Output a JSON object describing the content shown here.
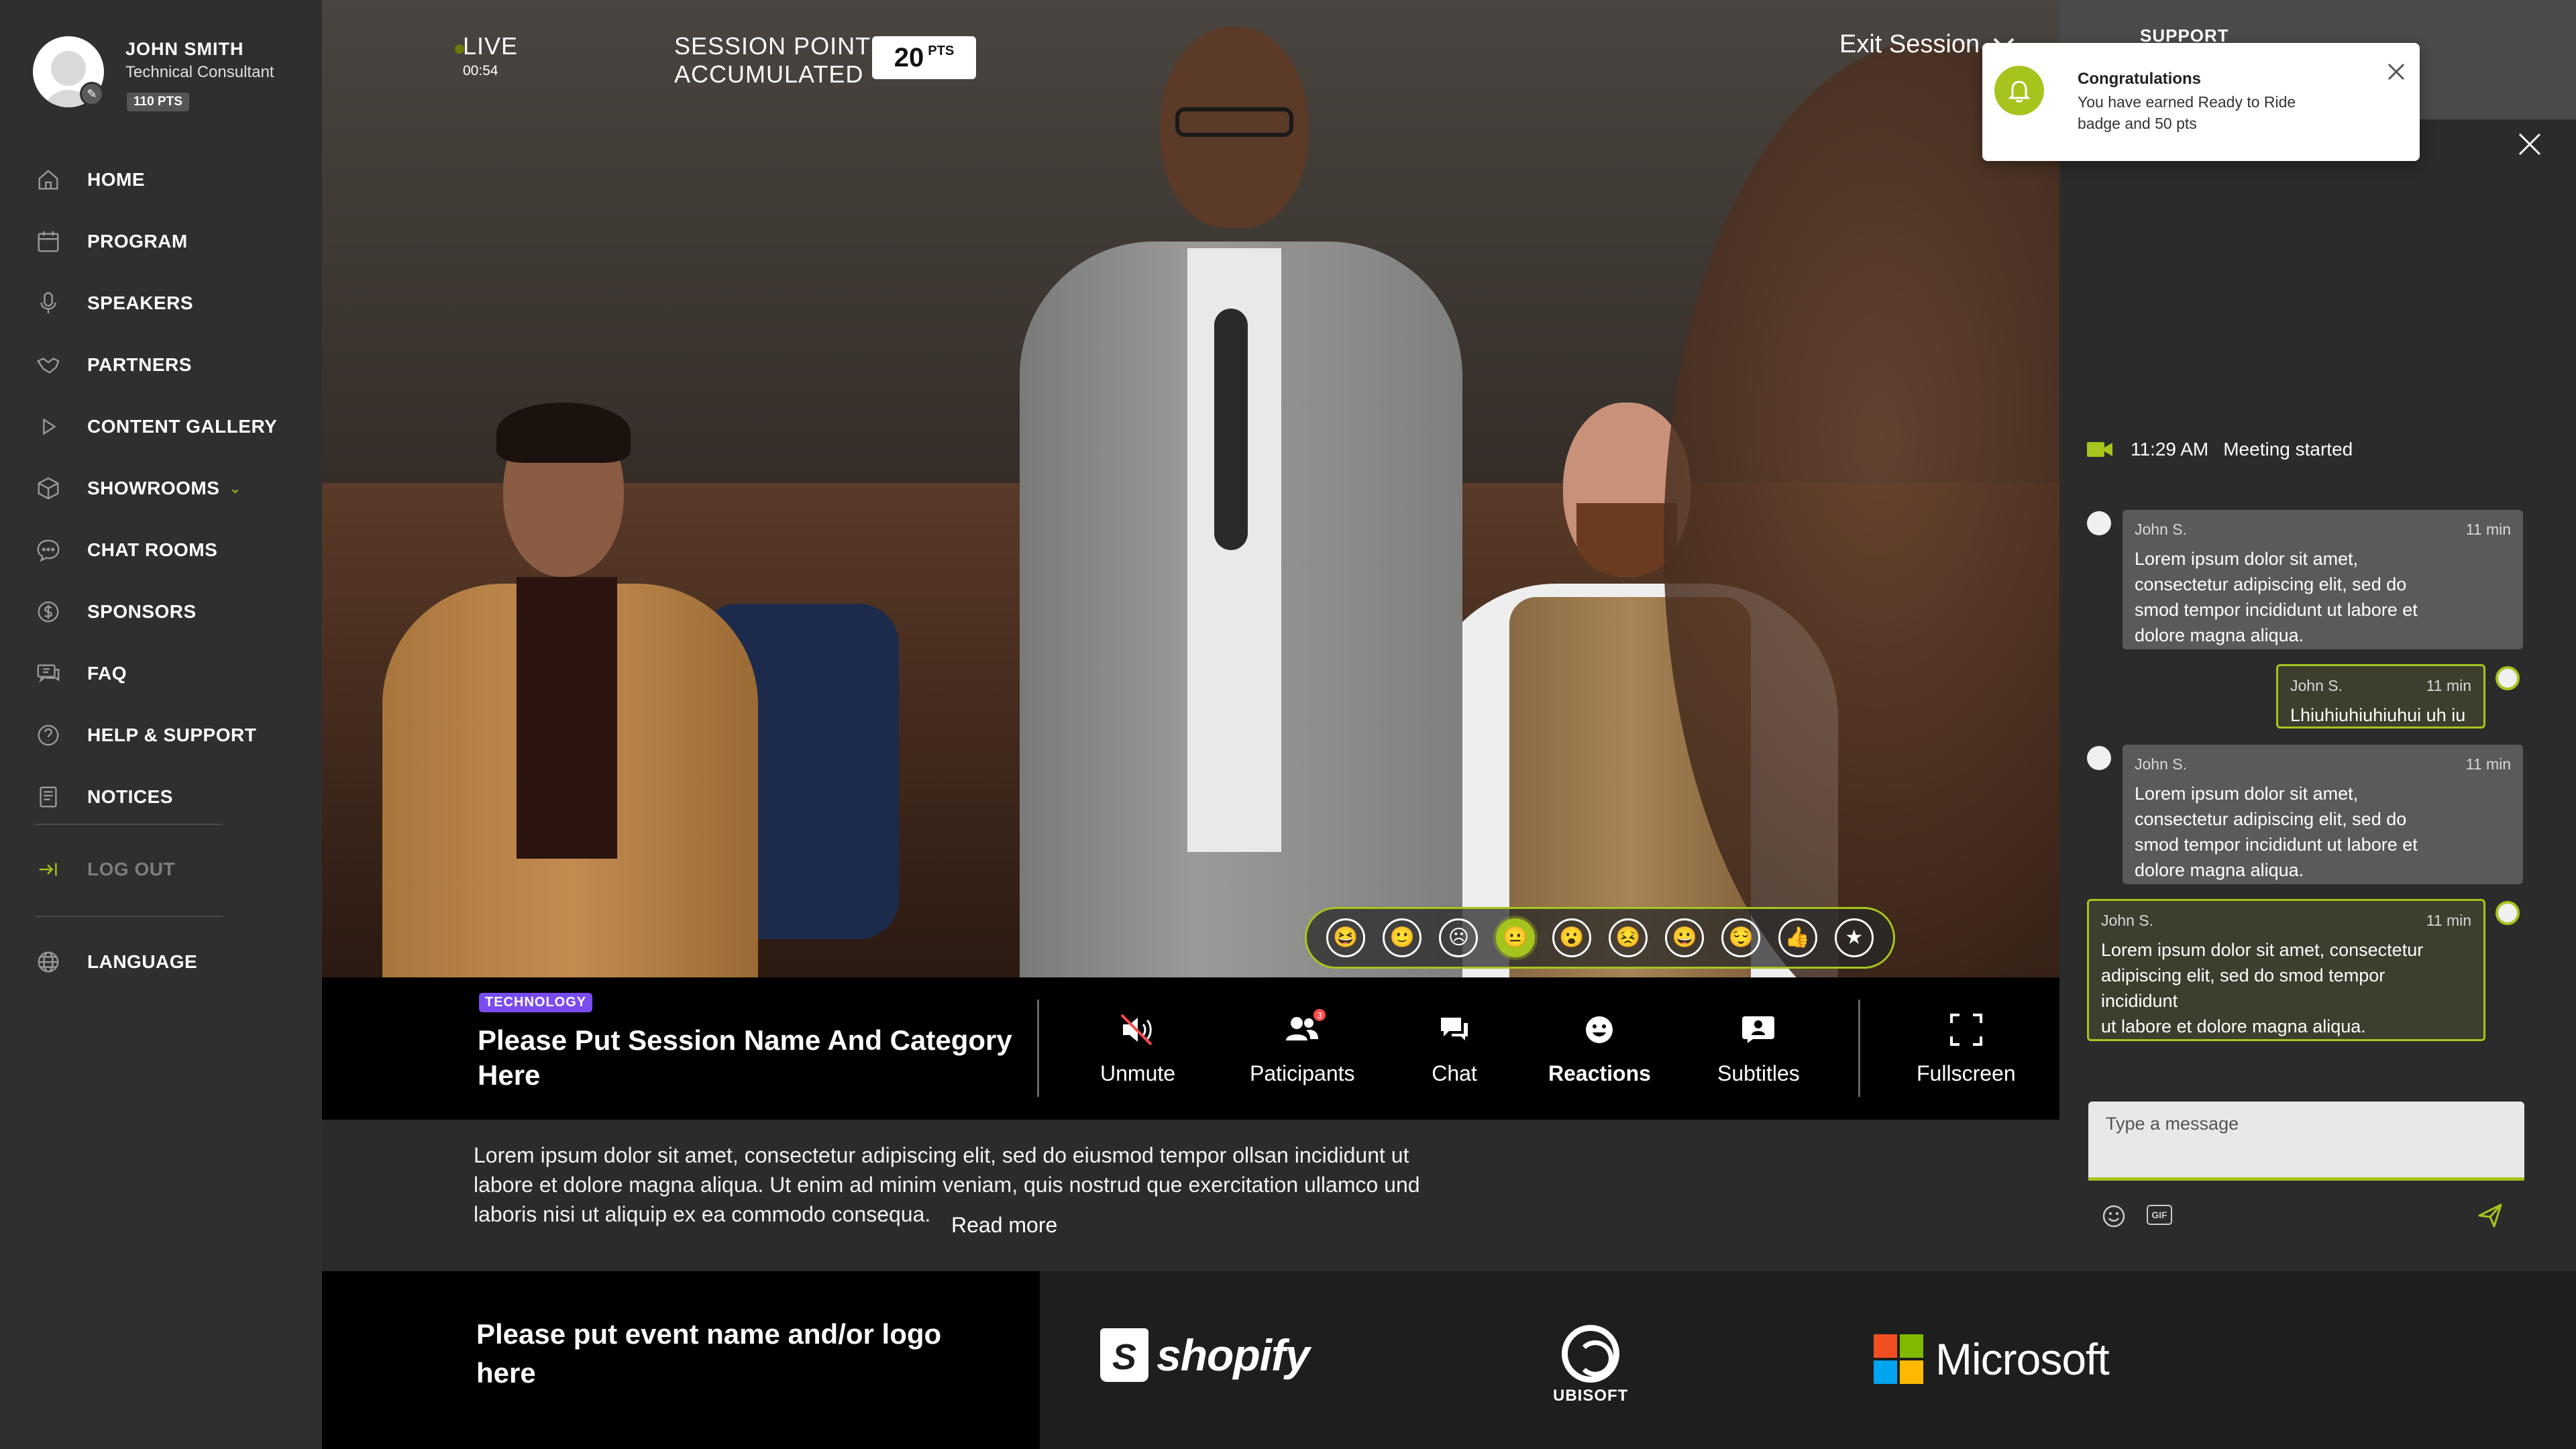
{
  "profile": {
    "name": "JOHN SMITH",
    "role": "Technical Consultant",
    "points": "110 PTS"
  },
  "nav": {
    "items": [
      {
        "label": "HOME",
        "icon": "home-icon"
      },
      {
        "label": "PROGRAM",
        "icon": "calendar-icon"
      },
      {
        "label": "SPEAKERS",
        "icon": "microphone-icon"
      },
      {
        "label": "PARTNERS",
        "icon": "handshake-icon"
      },
      {
        "label": "CONTENT GALLERY",
        "icon": "play-icon"
      },
      {
        "label": "SHOWROOMS",
        "icon": "cube-icon"
      },
      {
        "label": "CHAT ROOMS",
        "icon": "chat-bubble-icon"
      },
      {
        "label": "SPONSORS",
        "icon": "dollar-icon"
      },
      {
        "label": "FAQ",
        "icon": "faq-icon"
      },
      {
        "label": "HELP & SUPPORT",
        "icon": "help-icon"
      },
      {
        "label": "NOTICES",
        "icon": "notices-icon"
      }
    ],
    "logout": "LOG OUT",
    "language": "LANGUAGE"
  },
  "session": {
    "live_label": "LIVE",
    "live_time": "00:54",
    "points_label_line1": "SESSION POINTS",
    "points_label_line2": "ACCUMULATED",
    "points_value": "20",
    "points_unit": "PTS",
    "exit_label": "Exit Session",
    "tag": "TECHNOLOGY",
    "name": "Please Put Session Name And Category Here",
    "description": "Lorem ipsum dolor sit amet, consectetur adipiscing elit, sed do eiusmod tempor ollsan incididunt ut labore et dolore magna aliqua. Ut enim ad minim veniam, quis nostrud que exercitation ullamco  und laboris nisi ut aliquip ex ea commodo consequa.",
    "read_more": "Read more"
  },
  "reactions": {
    "icons": [
      "laughing-icon",
      "smile-icon",
      "sad-icon",
      "neutral-icon",
      "surprised-icon",
      "angry-icon",
      "happy-icon",
      "wink-icon",
      "thumbs-up-icon",
      "star-icon"
    ],
    "active_index": 3
  },
  "controls": {
    "unmute": "Unmute",
    "participants": "Paticipants",
    "participants_badge": "3",
    "chat": "Chat",
    "reactions": "Reactions",
    "subtitles": "Subtitles",
    "fullscreen": "Fullscreen"
  },
  "footer": {
    "event_name": "Please put event name and/or logo here",
    "sponsors": [
      "shopify",
      "UBISOFT",
      "Microsoft"
    ]
  },
  "panel": {
    "support_label": "SUPPORT",
    "toast": {
      "title": "Congratulations",
      "body": "You have earned Ready to Ride badge and 50 pts"
    },
    "meeting": {
      "time": "11:29 AM",
      "text": "Meeting started"
    },
    "messages": [
      {
        "author": "John S.",
        "time": "11 min",
        "text": "Lorem ipsum dolor sit amet,\nconsectetur adipiscing elit, sed do\nsmod tempor incididunt ut labore et\ndolore magna aliqua.",
        "outgoing": false
      },
      {
        "author": "John S.",
        "time": "11 min",
        "text": "Lhiuhiuhiuhiuhui uh iu",
        "outgoing": true
      },
      {
        "author": "John S.",
        "time": "11 min",
        "text": "Lorem ipsum dolor sit amet,\nconsectetur adipiscing elit, sed do\nsmod tempor incididunt ut labore et\ndolore magna aliqua.",
        "outgoing": false
      },
      {
        "author": "John S.",
        "time": "11 min",
        "text": "Lorem ipsum dolor sit amet, consectetur\nadipiscing elit, sed do smod tempor\nincididunt\nut labore et dolore magna aliqua.",
        "outgoing": true
      }
    ],
    "composer_placeholder": "Type a message",
    "gif_label": "GIF"
  },
  "colors": {
    "accent": "#a6c41e",
    "sidebar_bg": "#2f2f2f",
    "tag_bg": "#7a4cf0"
  }
}
